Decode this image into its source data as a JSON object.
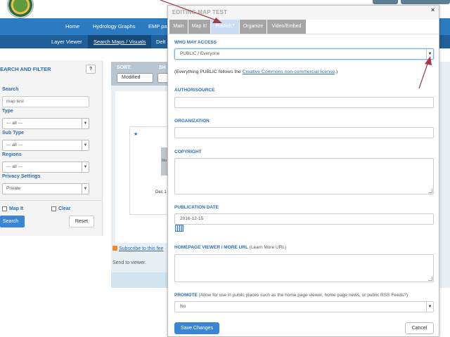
{
  "nav": {
    "main_items": [
      "Home",
      "Hydrology Graphs",
      "EMP pa"
    ],
    "sub_items": [
      "Layer Viewer",
      "Search Maps / Visuals",
      "Delt"
    ]
  },
  "sidebar": {
    "title": "EARCH AND FILTER",
    "help": "?",
    "search_label": "Search",
    "search_value": "map test",
    "type_label": "Type",
    "type_value": "--- all ---",
    "subtype_label": "Sub Type",
    "subtype_value": "--- all ---",
    "regions_label": "Regions",
    "regions_value": "--- all ---",
    "privacy_label": "Privacy Settings",
    "privacy_value": "Private",
    "map_it_label": "Map It",
    "clear_label": "Clear",
    "search_button": "Search",
    "reset_button": "Reset"
  },
  "results": {
    "sort_label": "SORT:",
    "sort_label2": "SH",
    "sort_value": "Modified",
    "card_star": "★",
    "card_thumb_text": "Mo",
    "card_date": "Dec 1",
    "rss_text": "Subscribe to this fee",
    "send_text": "Send to viewer."
  },
  "modal": {
    "title": "EDITING MAP TEST",
    "close": "×",
    "tabs": [
      "Main",
      "Map It!",
      "Publish?",
      "Organize",
      "Video/Embed"
    ],
    "active_tab": "Publish?",
    "who_label": "WHO MAY ACCESS",
    "who_value": "PUBLIC / Everyone",
    "note_pre": "(Everything PUBLIC follows the ",
    "note_link": "Creative Commons non-commercial license",
    "note_post": ".)",
    "author_label": "AUTHOR/SOURCE",
    "author_value": "",
    "org_label": "ORGANIZATION",
    "org_value": "",
    "copyright_label": "COPYRIGHT",
    "pubdate_label": "PUBLICATION DATE",
    "pubdate_value": "2016-12-15",
    "homepage_label": "HOMEPAGE VIEWER / MORE URL",
    "homepage_note": " (Learn More URL)",
    "promote_label": "PROMOTE",
    "promote_note": " (Allow for use in public places such as the home page viewer, home page news, or public RSS Feeds?)",
    "promote_value": "No",
    "save_button": "Save Changes",
    "cancel_button": "Cancel"
  },
  "colors": {
    "nav_main": "#2c7bc0",
    "nav_sub": "#1f5f9a",
    "accent": "#2b6cb0",
    "button_primary": "#3a86d4",
    "tab_inactive": "#a5a5a5",
    "tab_active": "#c9def4",
    "annotation_arrow": "#a33a48"
  }
}
